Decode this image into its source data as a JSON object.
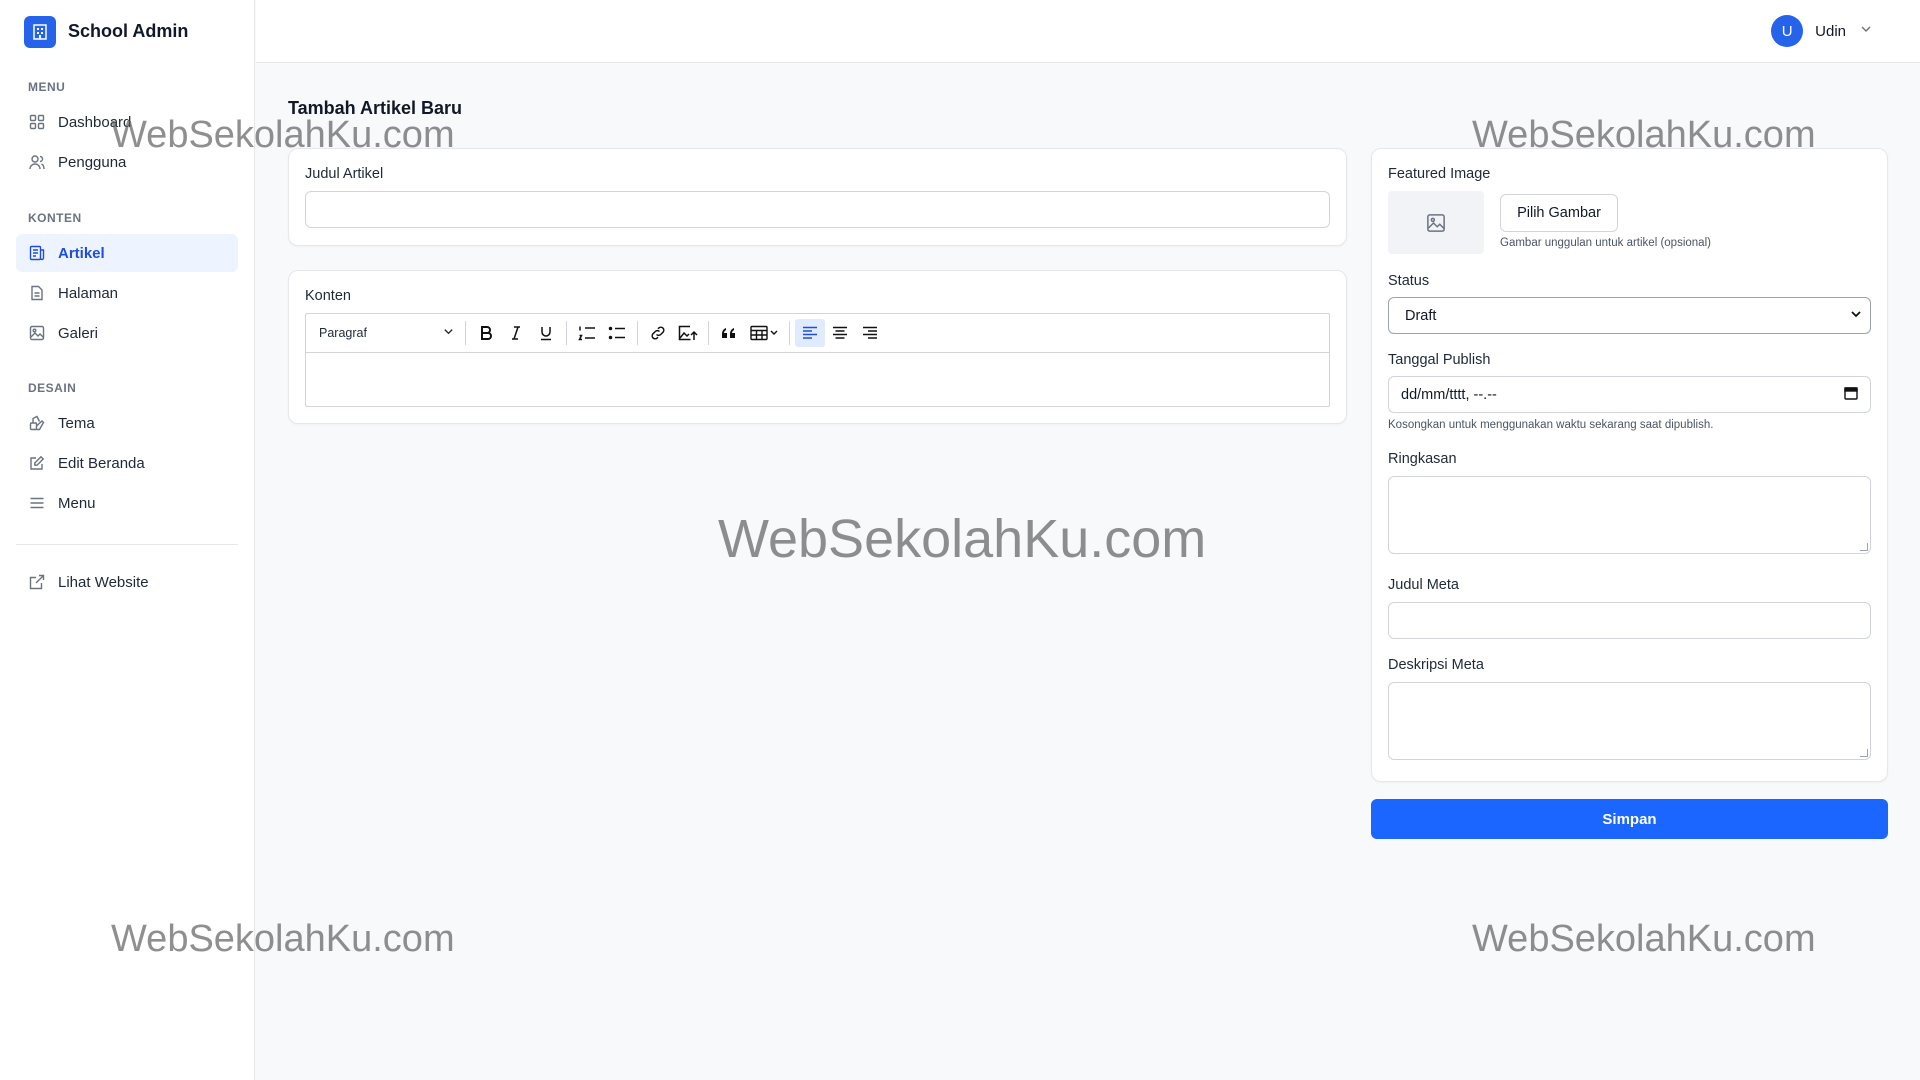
{
  "brand": {
    "title": "School Admin"
  },
  "sidebar": {
    "sections": [
      {
        "title": "MENU",
        "items": [
          {
            "label": "Dashboard"
          },
          {
            "label": "Pengguna"
          }
        ]
      },
      {
        "title": "KONTEN",
        "items": [
          {
            "label": "Artikel"
          },
          {
            "label": "Halaman"
          },
          {
            "label": "Galeri"
          }
        ]
      },
      {
        "title": "DESAIN",
        "items": [
          {
            "label": "Tema"
          },
          {
            "label": "Edit Beranda"
          },
          {
            "label": "Menu"
          }
        ]
      }
    ],
    "footer_link": "Lihat Website",
    "active_item": "Artikel"
  },
  "topbar": {
    "avatar_initial": "U",
    "user_name": "Udin"
  },
  "page": {
    "title": "Tambah Artikel Baru"
  },
  "form": {
    "title_label": "Judul Artikel",
    "title_value": "",
    "content_label": "Konten",
    "editor": {
      "paragraph_format": "Paragraf"
    },
    "featured_image_label": "Featured Image",
    "choose_image_button": "Pilih Gambar",
    "featured_image_hint": "Gambar unggulan untuk artikel (opsional)",
    "status_label": "Status",
    "status_value": "Draft",
    "publish_date_label": "Tanggal Publish",
    "publish_date_placeholder": "dd/mm/tttt, --.--",
    "publish_date_hint": "Kosongkan untuk menggunakan waktu sekarang saat dipublish.",
    "summary_label": "Ringkasan",
    "meta_title_label": "Judul Meta",
    "meta_description_label": "Deskripsi Meta",
    "save_button": "Simpan"
  },
  "watermark": "WebSekolahKu.com",
  "colors": {
    "primary": "#1a66ff",
    "active_bg": "#eef4ff",
    "active_text": "#1d4ed8"
  }
}
